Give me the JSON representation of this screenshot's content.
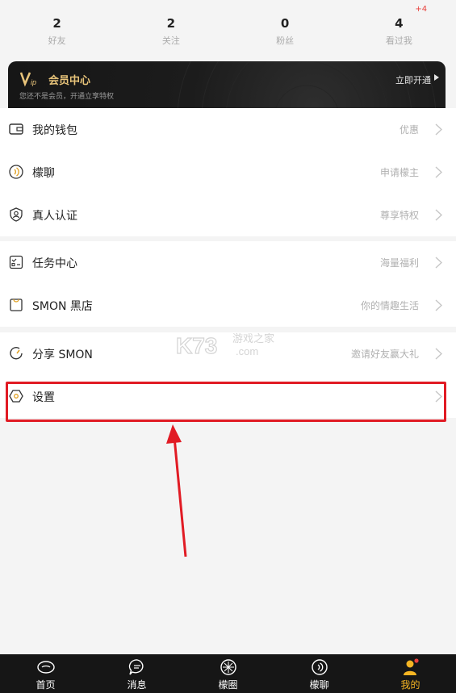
{
  "stats": [
    {
      "count": "2",
      "label": "好友"
    },
    {
      "count": "2",
      "label": "关注"
    },
    {
      "count": "0",
      "label": "粉丝"
    },
    {
      "count": "4",
      "label": "看过我",
      "badge": "+4"
    }
  ],
  "vip": {
    "title": "会员中心",
    "subtitle": "您还不是会员，开通立享特权",
    "action": "立即开通",
    "accent": "#e8c47a"
  },
  "menu_group_1": [
    {
      "title": "我的钱包",
      "hint": "优惠"
    },
    {
      "title": "檬聊",
      "hint": "申请檬主"
    },
    {
      "title": "真人认证",
      "hint": "尊享特权"
    }
  ],
  "menu_group_2": [
    {
      "title": "任务中心",
      "hint": "海量福利"
    },
    {
      "title": "SMON 黑店",
      "hint": "你的情趣生活"
    }
  ],
  "menu_group_3": [
    {
      "title": "分享 SMON",
      "hint": "邀请好友赢大礼"
    },
    {
      "title": "设置",
      "hint": ""
    }
  ],
  "bottom_nav": [
    {
      "label": "首页",
      "icon": "home-icon"
    },
    {
      "label": "消息",
      "icon": "message-icon"
    },
    {
      "label": "檬圈",
      "icon": "circle-icon"
    },
    {
      "label": "檬聊",
      "icon": "chat-icon"
    },
    {
      "label": "我的",
      "icon": "profile-icon",
      "active": true
    }
  ],
  "colors": {
    "active_tab": "#f5b523",
    "highlight": "#e11b24",
    "badge": "#e8413c"
  },
  "watermark": {
    "brand": "K73",
    "text_cn": "游戏之家",
    "suffix": ".com"
  }
}
